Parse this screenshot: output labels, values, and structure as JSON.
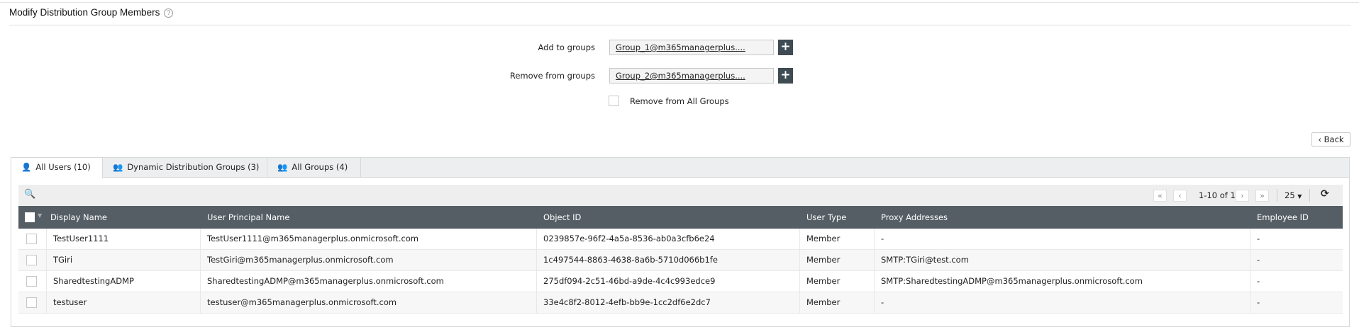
{
  "page": {
    "title": "Modify Distribution Group Members",
    "help_icon": "?"
  },
  "form": {
    "add_label": "Add to groups",
    "add_value": "Group_1@m365managerplus....",
    "remove_label": "Remove from groups",
    "remove_value": "Group_2@m365managerplus....",
    "plus": "+",
    "remove_all_label": "Remove from All Groups"
  },
  "back_label": "Back",
  "tabs": [
    {
      "label": "All Users (10)"
    },
    {
      "label": "Dynamic Distribution Groups (3)"
    },
    {
      "label": "All Groups (4)"
    }
  ],
  "pagination": {
    "range": "1-10 of 10",
    "page_size": "25",
    "first": "«",
    "prev": "‹",
    "next": "›",
    "last": "»"
  },
  "columns": [
    "Display Name",
    "User Principal Name",
    "Object ID",
    "User Type",
    "Proxy Addresses",
    "Employee ID"
  ],
  "rows": [
    [
      "TestUser1111",
      "TestUser1111@m365managerplus.onmicrosoft.com",
      "0239857e-96f2-4a5a-8536-ab0a3cfb6e24",
      "Member",
      "-",
      "-"
    ],
    [
      "TGiri",
      "TestGiri@m365managerplus.onmicrosoft.com",
      "1c497544-8863-4638-8a6b-5710d066b1fe",
      "Member",
      "SMTP:TGiri@test.com",
      "-"
    ],
    [
      "SharedtestingADMP",
      "SharedtestingADMP@m365managerplus.onmicrosoft.com",
      "275df094-2c51-46bd-a9de-4c4c993edce9",
      "Member",
      "SMTP:SharedtestingADMP@m365managerplus.onmicrosoft.com",
      "-"
    ],
    [
      "testuser",
      "testuser@m365managerplus.onmicrosoft.com",
      "33e4c8f2-8012-4efb-bb9e-1cc2df6e2dc7",
      "Member",
      "-",
      "-"
    ]
  ]
}
